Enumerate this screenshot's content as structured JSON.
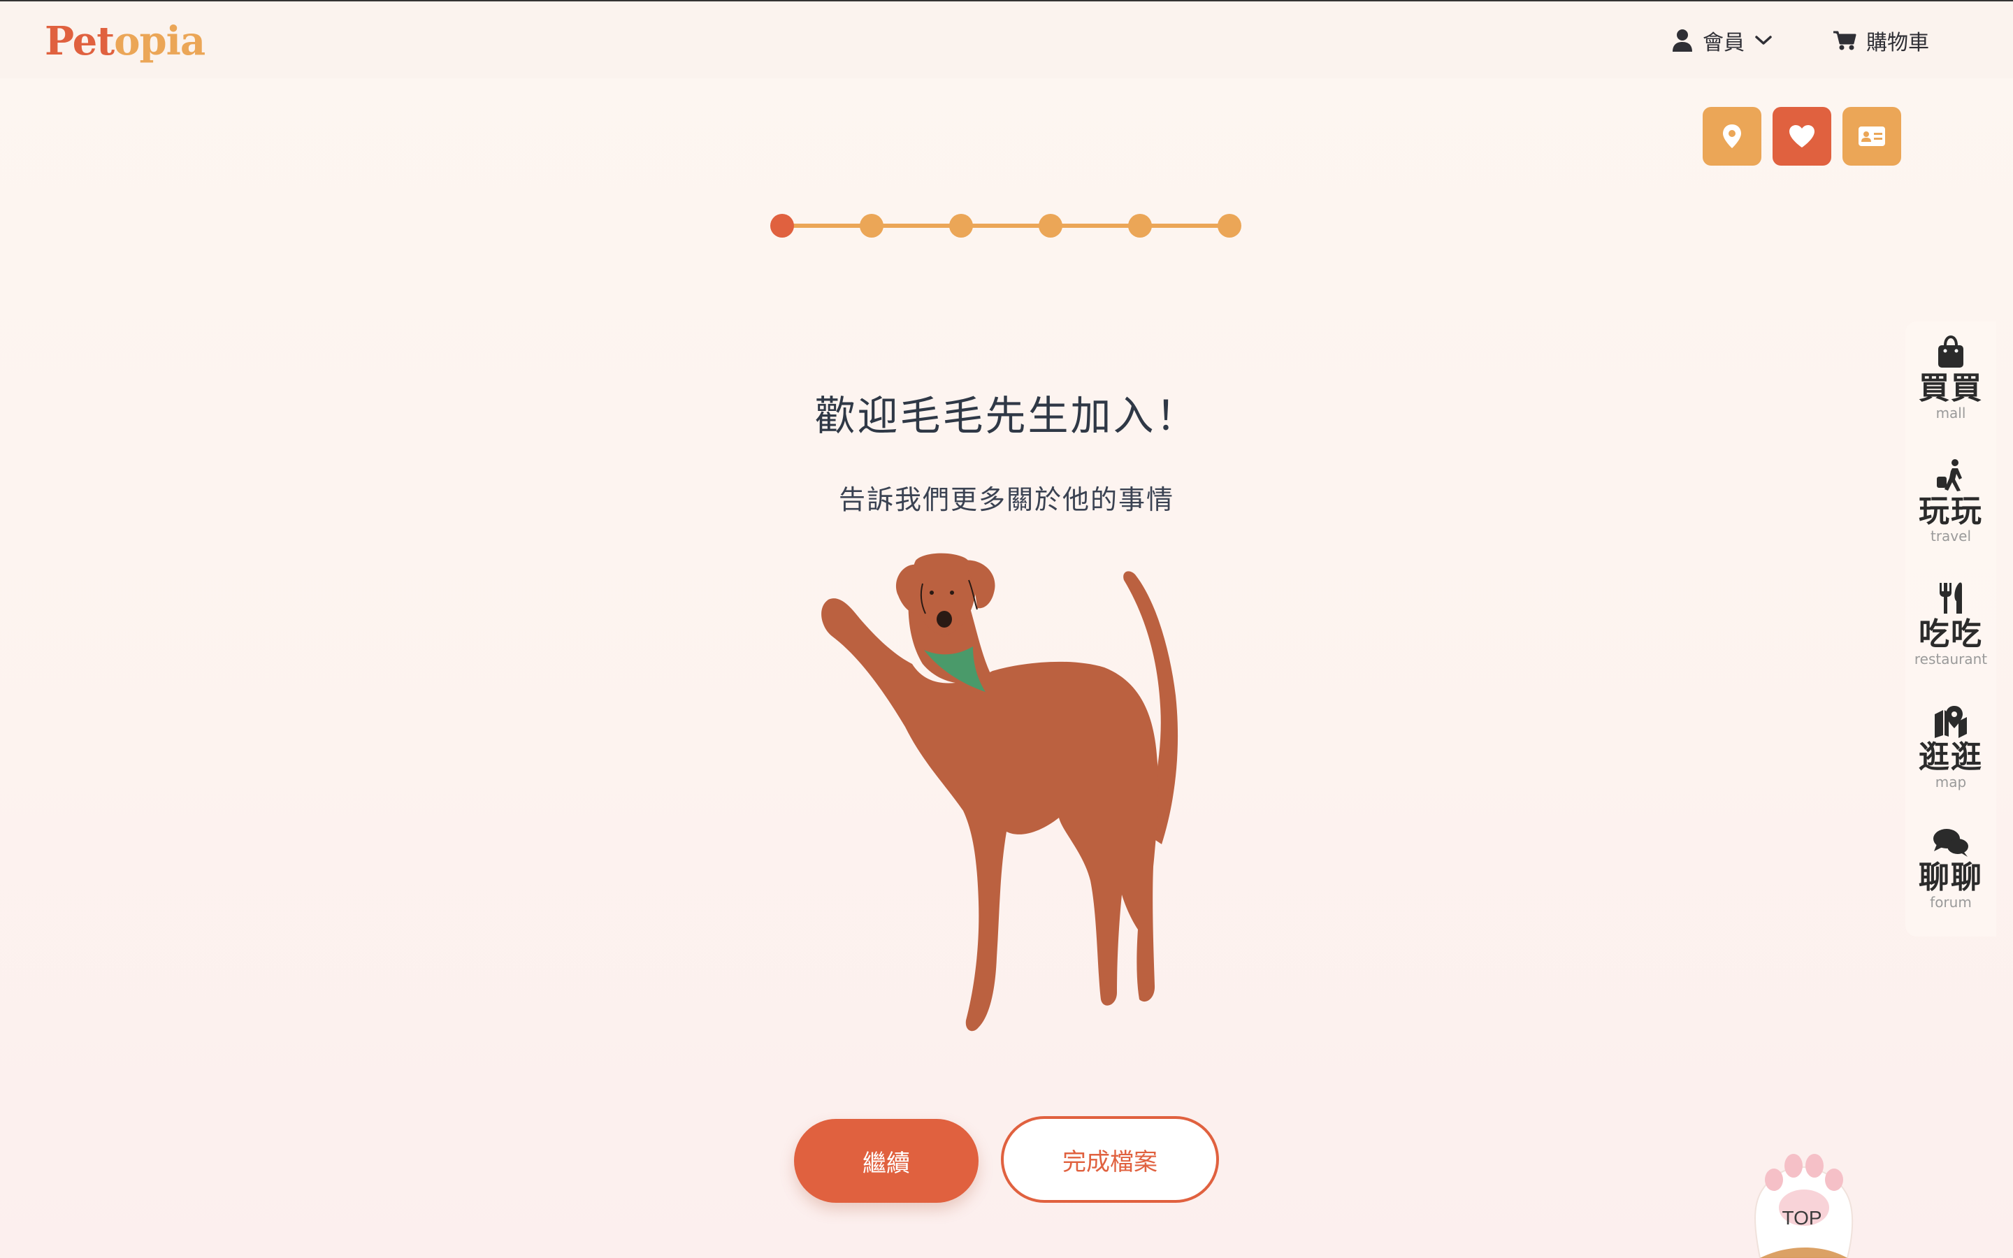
{
  "header": {
    "logo": {
      "part1": "Pet",
      "part2": "opia"
    },
    "member_label": "會員",
    "cart_label": "購物車"
  },
  "quick_actions": [
    {
      "icon": "map-pin-icon",
      "color": "#eba657"
    },
    {
      "icon": "heart-icon",
      "color": "#e0613f"
    },
    {
      "icon": "id-card-icon",
      "color": "#eba657"
    }
  ],
  "stepper": {
    "total_steps": 6,
    "current_step": 1
  },
  "main": {
    "title": "歡迎毛毛先生加入！",
    "subtitle": "告訴我們更多關於他的事情",
    "continue_label": "繼續",
    "finish_label": "完成檔案"
  },
  "sidebar": {
    "items": [
      {
        "zh": "買買",
        "en": "mall",
        "icon": "shopping-bag-icon"
      },
      {
        "zh": "玩玩",
        "en": "travel",
        "icon": "traveler-icon"
      },
      {
        "zh": "吃吃",
        "en": "restaurant",
        "icon": "utensils-icon"
      },
      {
        "zh": "逛逛",
        "en": "map",
        "icon": "map-marker-icon"
      },
      {
        "zh": "聊聊",
        "en": "forum",
        "icon": "chat-icon"
      }
    ]
  },
  "top_button": {
    "label": "TOP"
  },
  "colors": {
    "accent": "#e0613f",
    "secondary": "#eba657",
    "dog": "#bb6140",
    "bandana": "#4a9a6a"
  }
}
